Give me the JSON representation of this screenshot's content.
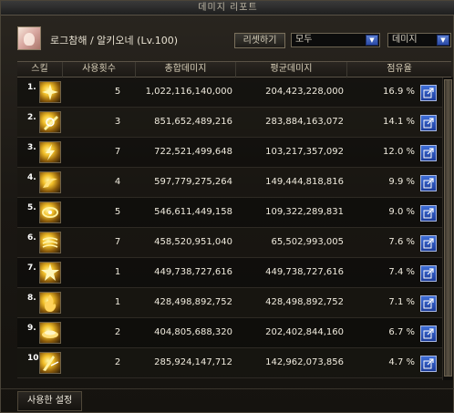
{
  "window": {
    "title": "데미지 리포트"
  },
  "player": {
    "name": "로그참해 / 알키오네 (Lv.100)"
  },
  "toolbar": {
    "reset_label": "리셋하기",
    "filter_select": "모두",
    "mode_select": "데미지"
  },
  "table": {
    "headers": [
      "스킬",
      "사용횟수",
      "총합데미지",
      "평균데미지",
      "점유율"
    ],
    "rows": [
      {
        "rank": "1.",
        "count": "5",
        "total": "1,022,116,140,000",
        "average": "204,423,228,000",
        "share": "16.9 %",
        "icon": "skill-icon-burst"
      },
      {
        "rank": "2.",
        "count": "3",
        "total": "851,652,489,216",
        "average": "283,884,163,072",
        "share": "14.1 %",
        "icon": "skill-icon-slash"
      },
      {
        "rank": "3.",
        "count": "7",
        "total": "722,521,499,648",
        "average": "103,217,357,092",
        "share": "12.0 %",
        "icon": "skill-icon-lightning"
      },
      {
        "rank": "4.",
        "count": "4",
        "total": "597,779,275,264",
        "average": "149,444,818,816",
        "share": "9.9 %",
        "icon": "skill-icon-whirl"
      },
      {
        "rank": "5.",
        "count": "5",
        "total": "546,611,449,158",
        "average": "109,322,289,831",
        "share": "9.0 %",
        "icon": "skill-icon-ring"
      },
      {
        "rank": "6.",
        "count": "7",
        "total": "458,520,951,040",
        "average": "65,502,993,005",
        "share": "7.6 %",
        "icon": "skill-icon-wind"
      },
      {
        "rank": "7.",
        "count": "1",
        "total": "449,738,727,616",
        "average": "449,738,727,616",
        "share": "7.4 %",
        "icon": "skill-icon-star"
      },
      {
        "rank": "8.",
        "count": "1",
        "total": "428,498,892,752",
        "average": "428,498,892,752",
        "share": "7.1 %",
        "icon": "skill-icon-flame"
      },
      {
        "rank": "9.",
        "count": "2",
        "total": "404,805,688,320",
        "average": "202,402,844,160",
        "share": "6.7 %",
        "icon": "skill-icon-disc"
      },
      {
        "rank": "10.",
        "count": "2",
        "total": "285,924,147,712",
        "average": "142,962,073,856",
        "share": "4.7 %",
        "icon": "skill-icon-strike"
      }
    ]
  },
  "footer": {
    "tab_label": "사용한 설정"
  },
  "colors": {
    "accent_blue": "#2a4aa8",
    "text": "#f0ebde",
    "border": "#5a5246"
  }
}
